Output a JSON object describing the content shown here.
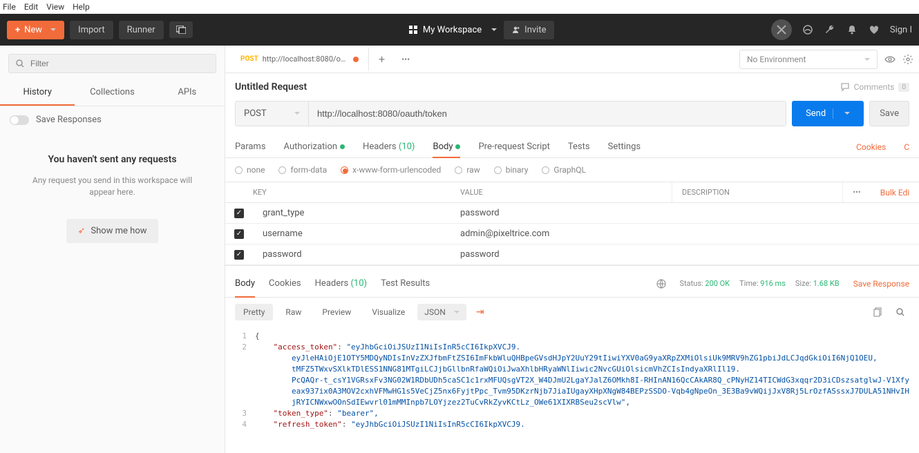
{
  "menubar": [
    "File",
    "Edit",
    "View",
    "Help"
  ],
  "topbar": {
    "new": "New",
    "import": "Import",
    "runner": "Runner",
    "workspace": "My Workspace",
    "invite": "Invite",
    "signin": "Sign I"
  },
  "sidebar": {
    "filter_placeholder": "Filter",
    "tabs": [
      "History",
      "Collections",
      "APIs"
    ],
    "save_responses": "Save Responses",
    "empty_title": "You haven't sent any requests",
    "empty_text": "Any request you send in this workspace will appear here.",
    "show_me": "Show me how"
  },
  "tabstrip": {
    "tab_method": "POST",
    "tab_title": "http://localhost:8080/oauth/to..."
  },
  "env": {
    "selected": "No Environment"
  },
  "request": {
    "title": "Untitled Request",
    "comments_label": "Comments",
    "comments_count": "0",
    "method": "POST",
    "url": "http://localhost:8080/oauth/token",
    "send": "Send",
    "save": "Save"
  },
  "req_tabs": {
    "params": "Params",
    "auth": "Authorization",
    "headers": "Headers",
    "headers_count": "(10)",
    "body": "Body",
    "prereq": "Pre-request Script",
    "tests": "Tests",
    "settings": "Settings",
    "cookies_link": "Cookies",
    "code_link": "C"
  },
  "body_types": {
    "none": "none",
    "formdata": "form-data",
    "urlencoded": "x-www-form-urlencoded",
    "raw": "raw",
    "binary": "binary",
    "graphql": "GraphQL"
  },
  "kv": {
    "hkey": "KEY",
    "hval": "VALUE",
    "hdesc": "DESCRIPTION",
    "bulk": "Bulk Edi",
    "rows": [
      {
        "key": "grant_type",
        "value": "password"
      },
      {
        "key": "username",
        "value": "admin@pixeltrice.com"
      },
      {
        "key": "password",
        "value": "password"
      }
    ]
  },
  "resp_tabs": {
    "body": "Body",
    "cookies": "Cookies",
    "headers": "Headers",
    "headers_count": "(10)",
    "tests": "Test Results"
  },
  "resp_meta": {
    "status_label": "Status:",
    "status": "200 OK",
    "time_label": "Time:",
    "time": "916 ms",
    "size_label": "Size:",
    "size": "1.68 KB",
    "save": "Save Response"
  },
  "view": {
    "pretty": "Pretty",
    "raw": "Raw",
    "preview": "Preview",
    "visualize": "Visualize",
    "format": "JSON"
  },
  "json": {
    "l1_open": "{",
    "k_access": "\"access_token\"",
    "v_access_1": "\"eyJhbGciOiJSUzI1NiIsInR5cCI6IkpXVCJ9.",
    "v_access_2": "eyJleHAiOjE1OTY5MDQyNDIsInVzZXJfbmFtZSI6ImFkbWluQHBpeGVsdHJpY2UuY29tIiwiYXV0aG9yaXRpZXMiOlsiUk9MRV9hZG1pbiJdLCJqdGkiOiI6NjQ1OEU,",
    "v_access_3": "tMFZ5TWxvSXlkTDlESS1NNG81MTgiLCJjbGllbnRfaWQiOiJwaXhlbHRyaWNlIiwic2NvcGUiOlsicmVhZCIsIndyaXRlIl19.",
    "v_access_4": "PcQAQr-t_csY1VGRsxFv3NG02W1RDbUDh5caSC1c1rxMFUQsgVT2X_W4DJmU2LgaYJalZ6OMkh8I-RHInAN16QcCAkAR8Q_cPNyHZ14TICWdG3xqqr2D3iCDszsatglwJ-V1Xfy",
    "v_access_5": "eax937ix0A3MOV2cxhVFMwHG1s5VeCjZ5nx6FyjtPpc_Tvm95DKzrNjb7JiaIUgayXHpXNgW84BEPzSSDO-Vqb4gNpeOn_3E3Ba9vWQijJxV8Rj5LrOzfASssxJ7DULA51NHvIH",
    "v_access_6": "jRYICNWxwOOnSdIEwvrl01mMMInpb7LOYjzez2TuCvRkZyvKCtLz_OWe61XIXRBSeu2scVlw\",",
    "k_token_type": "\"token_type\"",
    "v_token_type": "\"bearer\",",
    "k_refresh": "\"refresh_token\"",
    "v_refresh_1": "\"eyJhbGciOiJSUzI1NiIsInR5cCI6IkpXVCJ9."
  }
}
